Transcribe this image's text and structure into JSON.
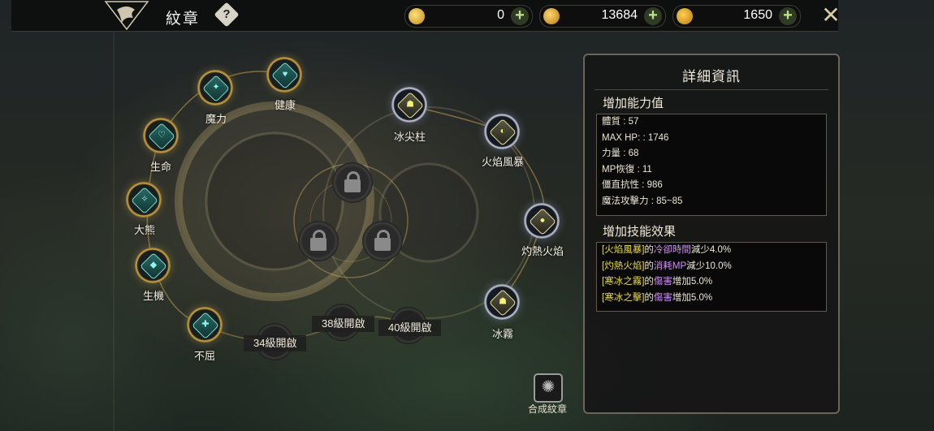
{
  "header": {
    "title": "紋章",
    "help_label": "?",
    "currencies": [
      {
        "icon": "refresh-token-icon",
        "value": "0",
        "add_label": "+"
      },
      {
        "icon": "gold-coin-stack-icon",
        "value": "13684",
        "add_label": "+"
      },
      {
        "icon": "gem-coin-icon",
        "value": "1650",
        "add_label": "+"
      }
    ],
    "close_label": "✕"
  },
  "emblems_left": [
    {
      "label": "健康",
      "icon": "heart-icon"
    },
    {
      "label": "魔力",
      "icon": "mana-vial-icon"
    },
    {
      "label": "生命",
      "icon": "life-heart-icon"
    },
    {
      "label": "大熊",
      "icon": "bear-icon"
    },
    {
      "label": "生機",
      "icon": "vitality-icon"
    },
    {
      "label": "不屈",
      "icon": "shield-cross-icon"
    }
  ],
  "emblems_right": [
    {
      "label": "冰尖柱",
      "icon": "ice-spike-icon"
    },
    {
      "label": "火焰風暴",
      "icon": "fire-storm-icon"
    },
    {
      "label": "灼熱火焰",
      "icon": "scorching-flame-icon"
    },
    {
      "label": "冰霧",
      "icon": "ice-fog-icon"
    }
  ],
  "locked_slots": [
    {
      "label": "34級開啟"
    },
    {
      "label": "38級開啟"
    },
    {
      "label": "40級開啟"
    }
  ],
  "synthesize": {
    "label": "合成紋章"
  },
  "details": {
    "title": "詳細資訊",
    "stats_title": "增加能力值",
    "stats": [
      "體質 : 57",
      "MAX HP:   : 1746",
      "力量 : 68",
      "MP恢復 : 11",
      "僵直抗性 : 986",
      "魔法攻擊力 : 85~85"
    ],
    "effects_title": "增加技能效果",
    "effects": [
      {
        "skill": "[火焰風暴]",
        "mid": "的",
        "attr": "冷卻時間",
        "change": "減少4.0%"
      },
      {
        "skill": "[灼熱火焰]",
        "mid": "的",
        "attr": "消耗MP",
        "change": "減少10.0%"
      },
      {
        "skill": "[寒冰之霧]",
        "mid": "的",
        "attr": "傷害",
        "change": "增加5.0%"
      },
      {
        "skill": "[寒冰之擊]",
        "mid": "的",
        "attr": "傷害",
        "change": "增加5.0%"
      }
    ]
  },
  "colors": {
    "gold_ring": "#c9a24a",
    "silver_ring": "#c4c9d6",
    "skill_name": "#e8da4a",
    "skill_attr": "#d68cff"
  }
}
